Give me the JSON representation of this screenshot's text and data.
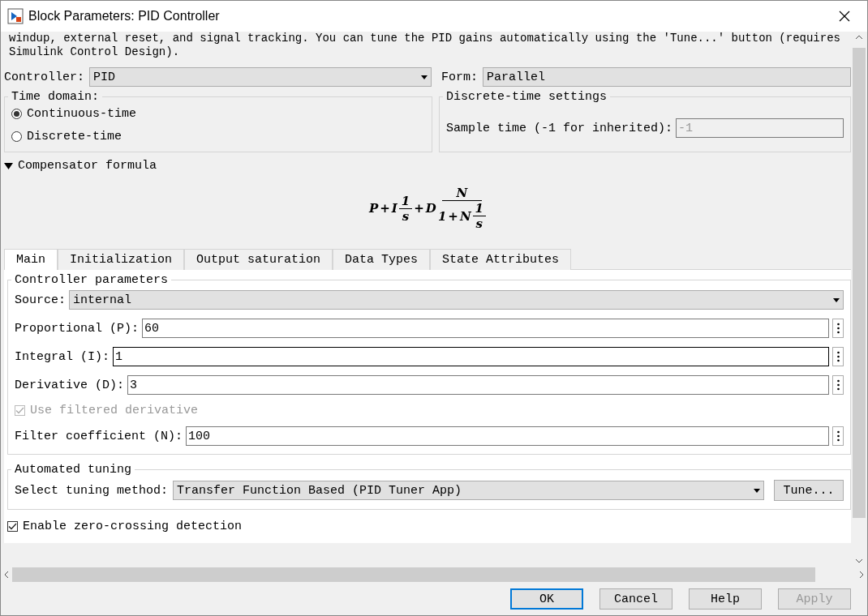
{
  "window": {
    "title": "Block Parameters: PID Controller"
  },
  "description": [
    "windup, external reset, and signal tracking. You can tune the PID gains automatically using the 'Tune...' button (requires",
    "Simulink Control Design)."
  ],
  "controller": {
    "label": "Controller:",
    "value": "PID"
  },
  "form": {
    "label": "Form:",
    "value": "Parallel"
  },
  "time_domain": {
    "title": "Time domain:",
    "options": [
      {
        "label": "Continuous-time",
        "selected": true
      },
      {
        "label": "Discrete-time",
        "selected": false
      }
    ]
  },
  "discrete_settings": {
    "title": "Discrete-time settings",
    "label": "Sample time (-1 for inherited):",
    "value": "-1",
    "disabled": true
  },
  "compensator": {
    "label": "Compensator formula",
    "expanded": true,
    "formula": {
      "p": "P",
      "plus1": "+",
      "i": "I",
      "one": "1",
      "s": "s",
      "plus2": "+",
      "d": "D",
      "n": "N",
      "den_one": "1",
      "den_plus": "+",
      "den_n": "N",
      "den_frac_one": "1",
      "den_frac_s": "s"
    }
  },
  "tabs": [
    {
      "label": "Main",
      "selected": true
    },
    {
      "label": "Initialization",
      "selected": false
    },
    {
      "label": "Output saturation",
      "selected": false
    },
    {
      "label": "Data Types",
      "selected": false
    },
    {
      "label": "State Attributes",
      "selected": false
    }
  ],
  "controller_parameters": {
    "title": "Controller parameters",
    "source": {
      "label": "Source:",
      "value": "internal"
    },
    "rows": [
      {
        "kind": "field",
        "label": "Proportional (P):",
        "value": "60",
        "focused": false
      },
      {
        "kind": "field",
        "label": "Integral (I):",
        "value": "1",
        "focused": true
      },
      {
        "kind": "field",
        "label": "Derivative (D):",
        "value": "3",
        "focused": false
      },
      {
        "kind": "checkbox",
        "label": "Use filtered derivative",
        "checked": true,
        "disabled": true
      },
      {
        "kind": "field",
        "label": "Filter coefficient (N):",
        "value": "100",
        "focused": false
      }
    ]
  },
  "automated_tuning": {
    "title": "Automated tuning",
    "label": "Select tuning method:",
    "value": "Transfer Function Based (PID Tuner App)",
    "button": "Tune..."
  },
  "zero_crossing": {
    "label": "Enable zero-crossing detection",
    "checked": true
  },
  "buttons": [
    {
      "label": "OK",
      "default": true,
      "disabled": false
    },
    {
      "label": "Cancel",
      "default": false,
      "disabled": false
    },
    {
      "label": "Help",
      "default": false,
      "disabled": false
    },
    {
      "label": "Apply",
      "default": false,
      "disabled": true
    }
  ]
}
